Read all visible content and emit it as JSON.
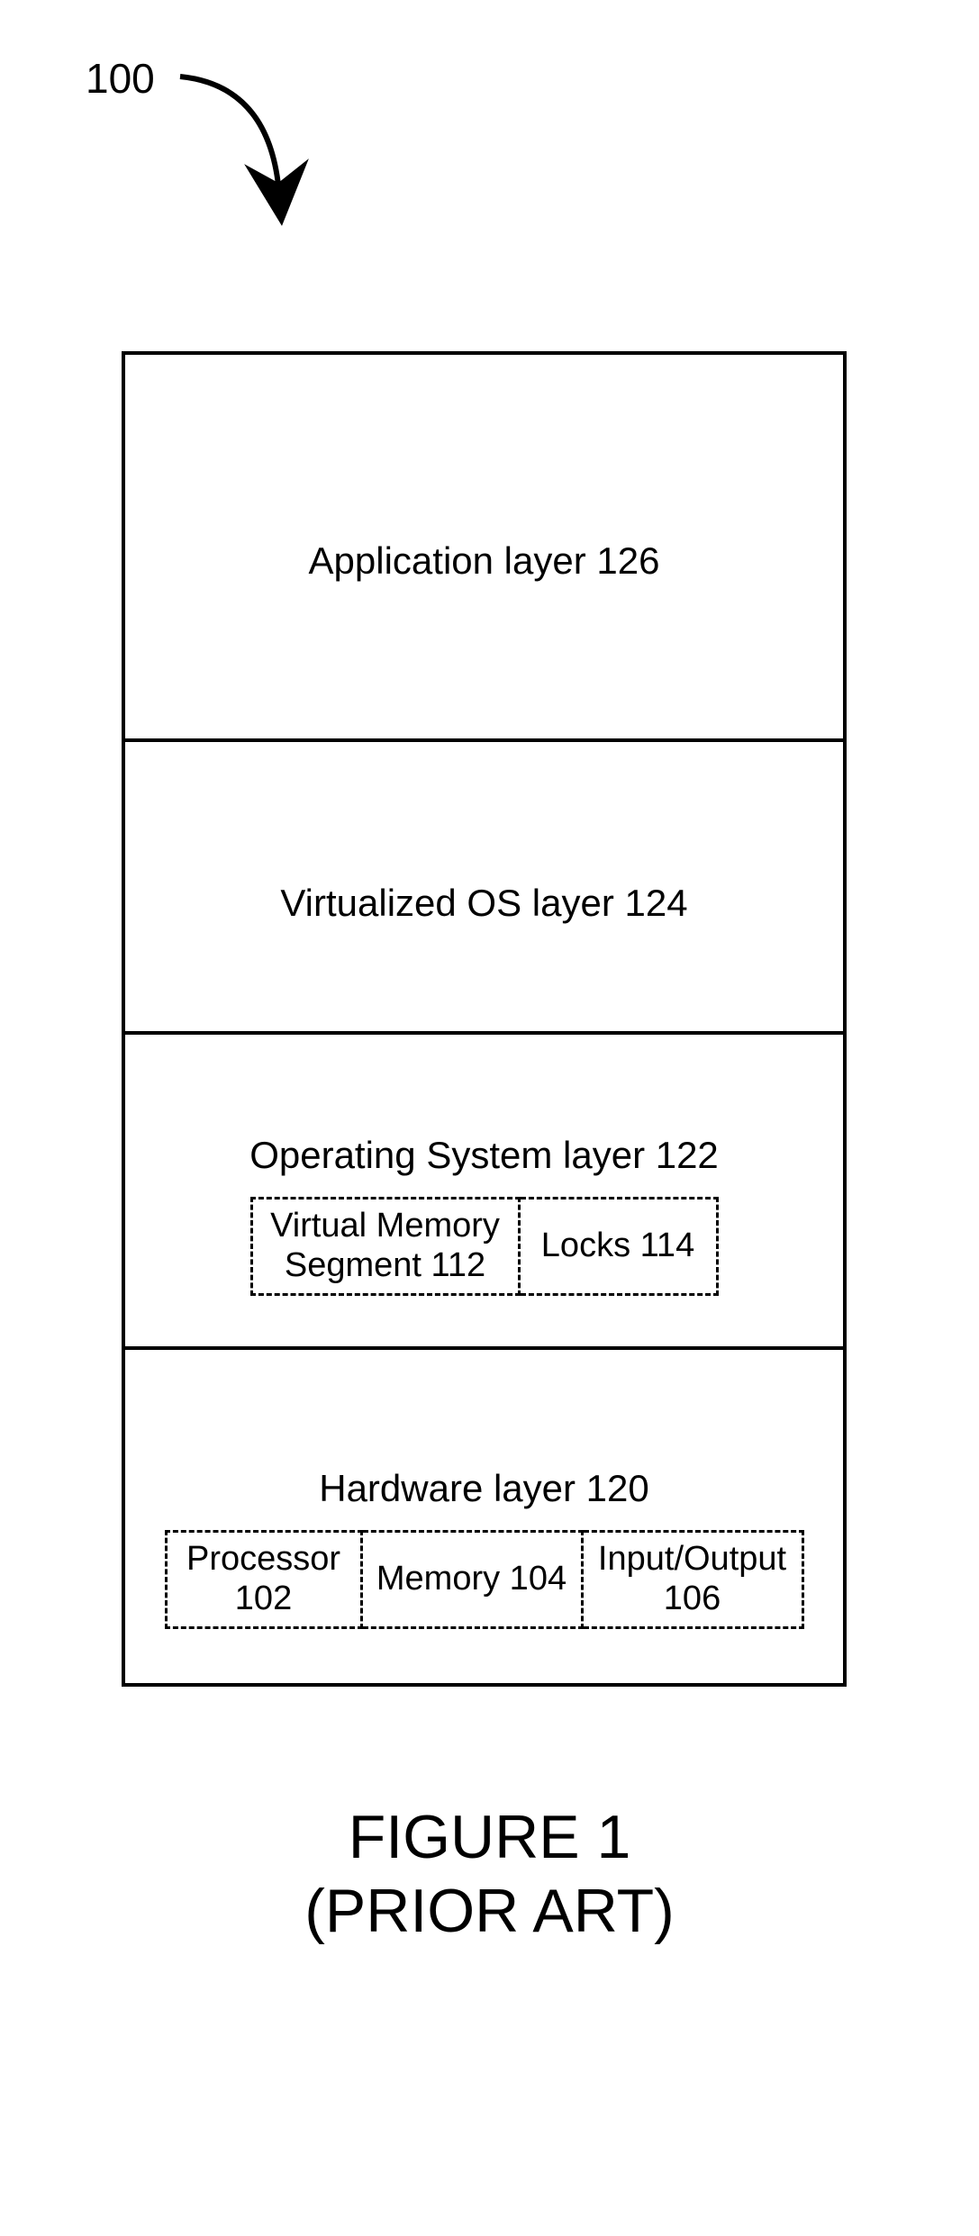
{
  "ref": "100",
  "layers": {
    "app": "Application layer 126",
    "vos": "Virtualized OS layer 124",
    "os": "Operating System layer 122",
    "hw": "Hardware layer 120"
  },
  "os_boxes": {
    "vmseg": "Virtual Memory\nSegment 112",
    "locks": "Locks 114"
  },
  "hw_boxes": {
    "proc": "Processor\n102",
    "mem": "Memory 104",
    "io": "Input/Output\n106"
  },
  "caption": {
    "line1": "FIGURE 1",
    "line2": "(PRIOR ART)"
  }
}
